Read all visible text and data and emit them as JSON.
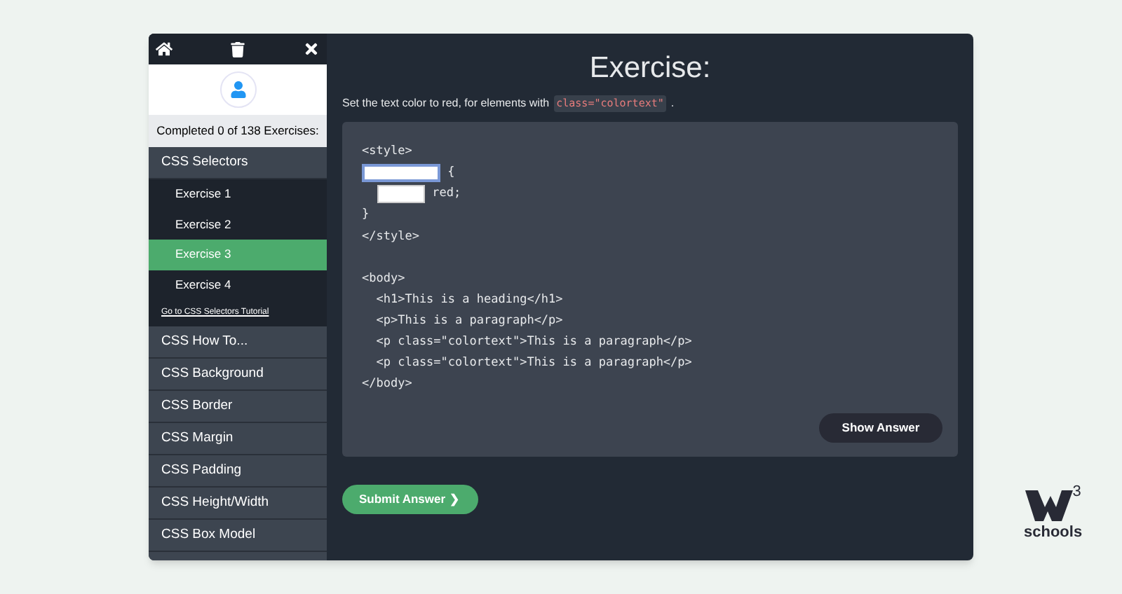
{
  "progress": "Completed 0 of 138 Exercises:",
  "sections": [
    {
      "label": "CSS Selectors",
      "exercises": [
        {
          "label": "Exercise 1",
          "selected": false
        },
        {
          "label": "Exercise 2",
          "selected": false
        },
        {
          "label": "Exercise 3",
          "selected": true
        },
        {
          "label": "Exercise 4",
          "selected": false
        }
      ],
      "tutorial_link": "Go to CSS Selectors Tutorial"
    },
    {
      "label": "CSS How To..."
    },
    {
      "label": "CSS Background"
    },
    {
      "label": "CSS Border"
    },
    {
      "label": "CSS Margin"
    },
    {
      "label": "CSS Padding"
    },
    {
      "label": "CSS Height/Width"
    },
    {
      "label": "CSS Box Model"
    }
  ],
  "exercise": {
    "title": "Exercise:",
    "instruction": "Set the text color to red, for elements with",
    "instruction_code": "class=\"colortext\"",
    "instruction_end": ".",
    "code_lines": [
      {
        "parts": [
          {
            "kind": "code",
            "text": "<style>"
          }
        ]
      },
      {
        "parts": [
          {
            "kind": "field",
            "focused": true
          },
          {
            "kind": "code",
            "text": " {"
          }
        ]
      },
      {
        "parts": [
          {
            "kind": "field",
            "focused": false
          },
          {
            "kind": "code",
            "text": " red;"
          }
        ]
      },
      {
        "parts": [
          {
            "kind": "code",
            "text": "}"
          }
        ]
      },
      {
        "parts": [
          {
            "kind": "code",
            "text": "</style>"
          }
        ]
      },
      {
        "parts": [
          {
            "kind": "blank"
          }
        ]
      },
      {
        "parts": [
          {
            "kind": "code",
            "text": "<body>"
          }
        ]
      },
      {
        "parts": [
          {
            "kind": "code",
            "text": "  <h1>This is a heading</h1>"
          }
        ]
      },
      {
        "parts": [
          {
            "kind": "code",
            "text": "  <p>This is a paragraph</p>"
          }
        ]
      },
      {
        "parts": [
          {
            "kind": "code",
            "text": "  <p class=\"colortext\">This is a paragraph</p>"
          }
        ]
      },
      {
        "parts": [
          {
            "kind": "code",
            "text": "  <p class=\"colortext\">This is a paragraph</p>"
          }
        ]
      },
      {
        "parts": [
          {
            "kind": "code",
            "text": "</body>"
          }
        ]
      }
    ],
    "show_answer": "Show Answer",
    "submit": "Submit Answer",
    "submit_icon": "❯"
  },
  "logo": {
    "superscript": "3",
    "wordmark": "schools"
  }
}
